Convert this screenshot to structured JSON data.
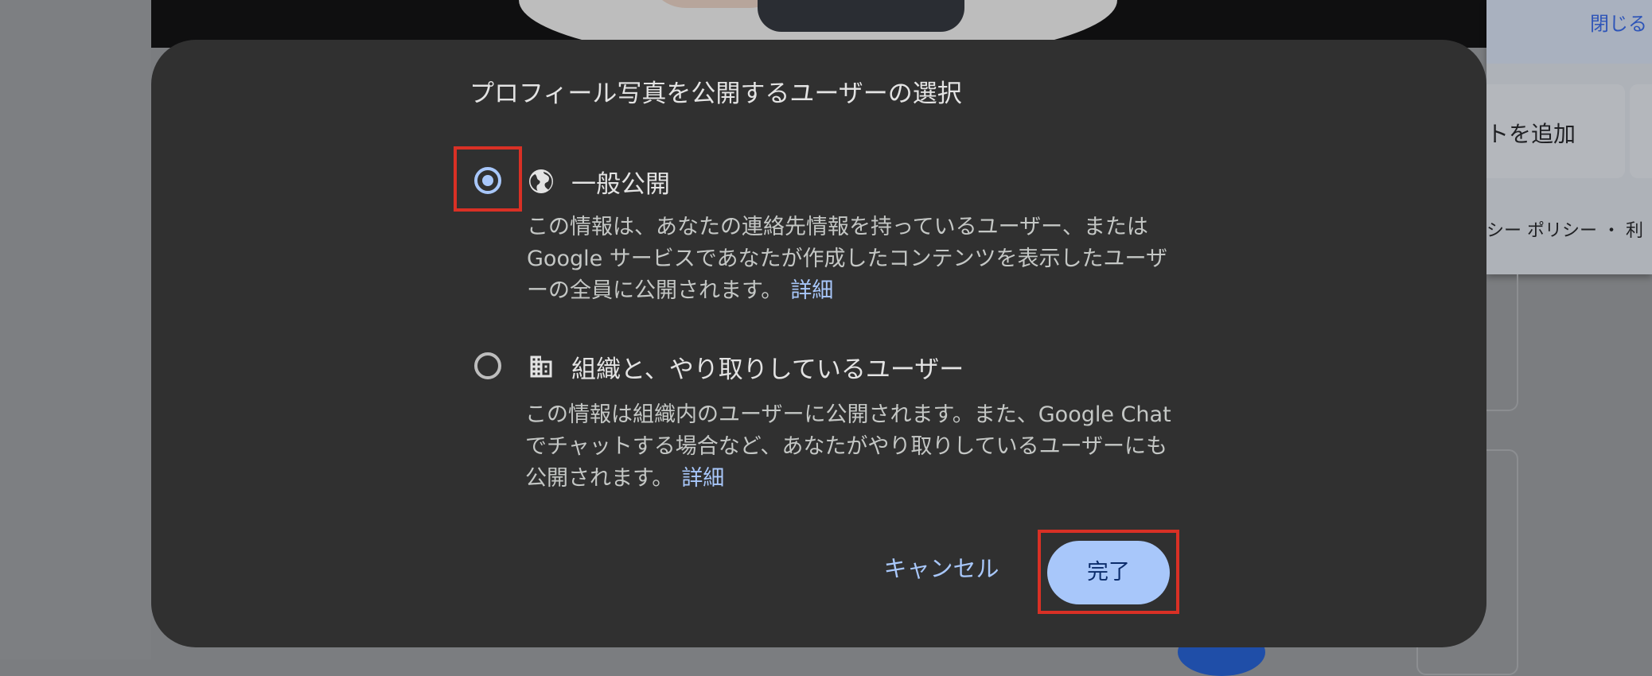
{
  "background": {
    "close_link": "閉じる",
    "add_text": "トを追加",
    "policy_text": "シー ポリシー ・ 利"
  },
  "dialog": {
    "title": "プロフィール写真を公開するユーザーの選択",
    "options": [
      {
        "label": "一般公開",
        "icon": "globe-icon",
        "selected": true,
        "description": "この情報は、あなたの連絡先情報を持っているユーザー、または Google サービスであなたが作成したコンテンツを表示したユーザーの全員に公開されます。",
        "link": "詳細"
      },
      {
        "label": "組織と、やり取りしているユーザー",
        "icon": "domain-icon",
        "selected": false,
        "description": "この情報は組織内のユーザーに公開されます。また、Google Chat でチャットする場合など、あなたがやり取りしているユーザーにも公開されます。",
        "link": "詳細"
      }
    ],
    "cancel_label": "キャンセル",
    "done_label": "完了"
  },
  "colors": {
    "dialog_bg": "#303030",
    "accent": "#a8c7fa",
    "highlight": "#d93025"
  }
}
